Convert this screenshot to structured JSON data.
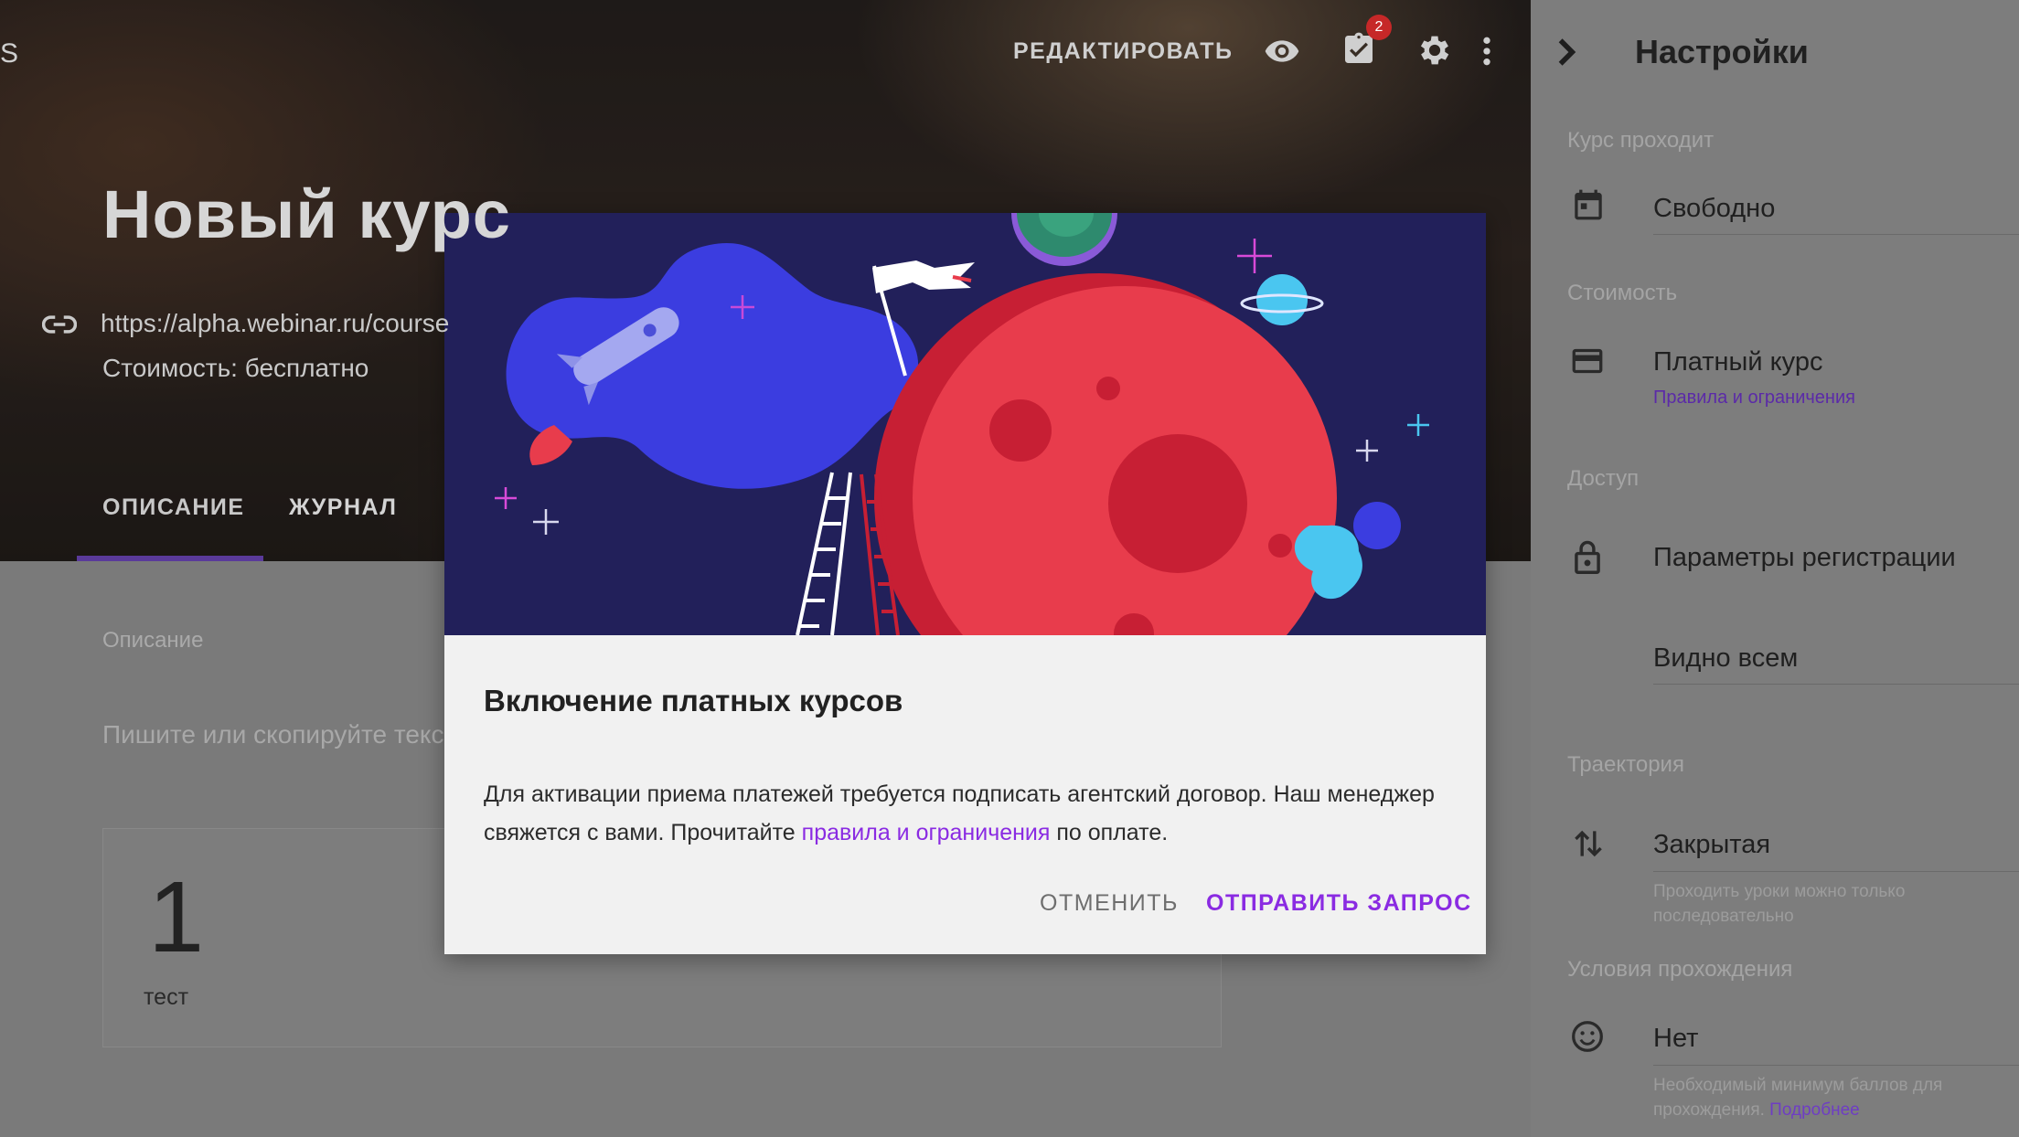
{
  "toolbar": {
    "cut_letter": "S",
    "edit_label": "РЕДАКТИРОВАТЬ",
    "tasks_badge": "2",
    "icons": [
      "eye-icon",
      "checklist-icon",
      "gear-icon",
      "more-vert-icon"
    ]
  },
  "course": {
    "title": "Новый курс",
    "url": "https://alpha.webinar.ru/course",
    "cost": "Стоимость: бесплатно",
    "tabs": [
      {
        "label": "ОПИСАНИЕ",
        "active": true
      },
      {
        "label": "ЖУРНАЛ",
        "active": false
      }
    ],
    "description_label": "Описание",
    "description_placeholder": "Пишите или скопируйте текст",
    "card": {
      "number": "1",
      "label": "тест"
    }
  },
  "settings": {
    "title": "Настройки",
    "sections": {
      "passing": {
        "label": "Курс проходит",
        "value": "Свободно",
        "icon": "calendar-icon"
      },
      "cost": {
        "label": "Стоимость",
        "value": "Платный курс",
        "link": "Правила и ограничения",
        "icon": "credit-card-icon"
      },
      "access": {
        "label": "Доступ",
        "value": "Параметры регистрации",
        "visibility": "Видно всем",
        "icon": "lock-icon"
      },
      "trajectory": {
        "label": "Траектория",
        "value": "Закрытая",
        "help": "Проходить уроки можно только последовательно",
        "icon": "swap-arrows-icon"
      },
      "conditions": {
        "label": "Условия прохождения",
        "value": "Нет",
        "help": "Необходимый минимум баллов для прохождения.",
        "help_link": "Подробнее",
        "icon": "smiley-icon"
      }
    }
  },
  "dialog": {
    "title": "Включение платных курсов",
    "text_before": "Для активации приема платежей требуется подписать агентский договор. Наш менеджер свяжется с вами. Прочитайте ",
    "text_link": "правила и ограничения",
    "text_after": " по оплате.",
    "cancel": "ОТМЕНИТЬ",
    "submit": "ОТПРАВИТЬ ЗАПРОС"
  },
  "colors": {
    "accent": "#8a2be2",
    "illustration_bg": "#22205a",
    "planet": "#e83c4c",
    "cloud": "#3b3de0",
    "badge": "#e53935"
  }
}
